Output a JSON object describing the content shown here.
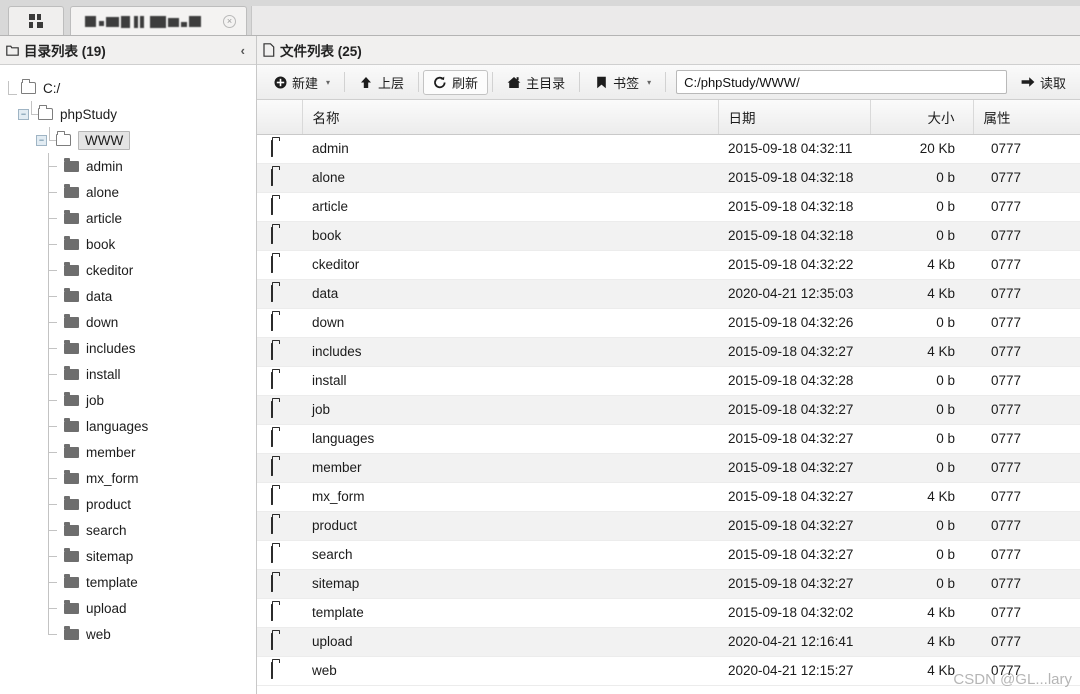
{
  "tabbar": {
    "grid_button": "grid-view",
    "tab_title": "",
    "tab_close": "×"
  },
  "sidebar": {
    "title": "目录列表 (19)",
    "collapse_icon": "‹",
    "header_icon": "folder-icon",
    "tree": [
      {
        "label": "C:/",
        "depth": 0,
        "type": "drive",
        "toggle": "",
        "selected": false
      },
      {
        "label": "phpStudy",
        "depth": 1,
        "type": "open",
        "toggle": "−",
        "selected": false
      },
      {
        "label": "WWW",
        "depth": 2,
        "type": "open",
        "toggle": "−",
        "selected": true
      },
      {
        "label": "admin",
        "depth": 3,
        "type": "leaf",
        "toggle": "",
        "selected": false
      },
      {
        "label": "alone",
        "depth": 3,
        "type": "leaf",
        "toggle": "",
        "selected": false
      },
      {
        "label": "article",
        "depth": 3,
        "type": "leaf",
        "toggle": "",
        "selected": false
      },
      {
        "label": "book",
        "depth": 3,
        "type": "leaf",
        "toggle": "",
        "selected": false
      },
      {
        "label": "ckeditor",
        "depth": 3,
        "type": "leaf",
        "toggle": "",
        "selected": false
      },
      {
        "label": "data",
        "depth": 3,
        "type": "leaf",
        "toggle": "",
        "selected": false
      },
      {
        "label": "down",
        "depth": 3,
        "type": "leaf",
        "toggle": "",
        "selected": false
      },
      {
        "label": "includes",
        "depth": 3,
        "type": "leaf",
        "toggle": "",
        "selected": false
      },
      {
        "label": "install",
        "depth": 3,
        "type": "leaf",
        "toggle": "",
        "selected": false
      },
      {
        "label": "job",
        "depth": 3,
        "type": "leaf",
        "toggle": "",
        "selected": false
      },
      {
        "label": "languages",
        "depth": 3,
        "type": "leaf",
        "toggle": "",
        "selected": false
      },
      {
        "label": "member",
        "depth": 3,
        "type": "leaf",
        "toggle": "",
        "selected": false
      },
      {
        "label": "mx_form",
        "depth": 3,
        "type": "leaf",
        "toggle": "",
        "selected": false
      },
      {
        "label": "product",
        "depth": 3,
        "type": "leaf",
        "toggle": "",
        "selected": false
      },
      {
        "label": "search",
        "depth": 3,
        "type": "leaf",
        "toggle": "",
        "selected": false
      },
      {
        "label": "sitemap",
        "depth": 3,
        "type": "leaf",
        "toggle": "",
        "selected": false
      },
      {
        "label": "template",
        "depth": 3,
        "type": "leaf",
        "toggle": "",
        "selected": false
      },
      {
        "label": "upload",
        "depth": 3,
        "type": "leaf",
        "toggle": "",
        "selected": false
      },
      {
        "label": "web",
        "depth": 3,
        "type": "leaf",
        "toggle": "",
        "selected": false
      }
    ]
  },
  "filelist": {
    "title": "文件列表 (25)",
    "header_icon": "document-icon",
    "toolbar": {
      "new_label": "新建",
      "new_icon": "plus-circle-icon",
      "up_label": "上层",
      "up_icon": "arrow-up-icon",
      "refresh_label": "刷新",
      "refresh_icon": "refresh-icon",
      "home_label": "主目录",
      "home_icon": "home-icon",
      "bookmark_label": "书签",
      "bookmark_icon": "bookmark-icon",
      "caret": "▾",
      "read_label": "读取",
      "read_icon": "arrow-right-icon"
    },
    "path_value": "C:/phpStudy/WWW/",
    "path_placeholder": "C:/",
    "columns": [
      "名称",
      "日期",
      "大小",
      "属性"
    ],
    "rows": [
      {
        "name": "admin",
        "date": "2015-09-18 04:32:11",
        "size": "20 Kb",
        "attr": "0777"
      },
      {
        "name": "alone",
        "date": "2015-09-18 04:32:18",
        "size": "0 b",
        "attr": "0777"
      },
      {
        "name": "article",
        "date": "2015-09-18 04:32:18",
        "size": "0 b",
        "attr": "0777"
      },
      {
        "name": "book",
        "date": "2015-09-18 04:32:18",
        "size": "0 b",
        "attr": "0777"
      },
      {
        "name": "ckeditor",
        "date": "2015-09-18 04:32:22",
        "size": "4 Kb",
        "attr": "0777"
      },
      {
        "name": "data",
        "date": "2020-04-21 12:35:03",
        "size": "4 Kb",
        "attr": "0777"
      },
      {
        "name": "down",
        "date": "2015-09-18 04:32:26",
        "size": "0 b",
        "attr": "0777"
      },
      {
        "name": "includes",
        "date": "2015-09-18 04:32:27",
        "size": "4 Kb",
        "attr": "0777"
      },
      {
        "name": "install",
        "date": "2015-09-18 04:32:28",
        "size": "0 b",
        "attr": "0777"
      },
      {
        "name": "job",
        "date": "2015-09-18 04:32:27",
        "size": "0 b",
        "attr": "0777"
      },
      {
        "name": "languages",
        "date": "2015-09-18 04:32:27",
        "size": "0 b",
        "attr": "0777"
      },
      {
        "name": "member",
        "date": "2015-09-18 04:32:27",
        "size": "0 b",
        "attr": "0777"
      },
      {
        "name": "mx_form",
        "date": "2015-09-18 04:32:27",
        "size": "4 Kb",
        "attr": "0777"
      },
      {
        "name": "product",
        "date": "2015-09-18 04:32:27",
        "size": "0 b",
        "attr": "0777"
      },
      {
        "name": "search",
        "date": "2015-09-18 04:32:27",
        "size": "0 b",
        "attr": "0777"
      },
      {
        "name": "sitemap",
        "date": "2015-09-18 04:32:27",
        "size": "0 b",
        "attr": "0777"
      },
      {
        "name": "template",
        "date": "2015-09-18 04:32:02",
        "size": "4 Kb",
        "attr": "0777"
      },
      {
        "name": "upload",
        "date": "2020-04-21 12:16:41",
        "size": "4 Kb",
        "attr": "0777"
      },
      {
        "name": "web",
        "date": "2020-04-21 12:15:27",
        "size": "4 Kb",
        "attr": "0777"
      }
    ]
  },
  "watermark": {
    "text": "CSDN @GL...lary",
    "sub": ""
  }
}
